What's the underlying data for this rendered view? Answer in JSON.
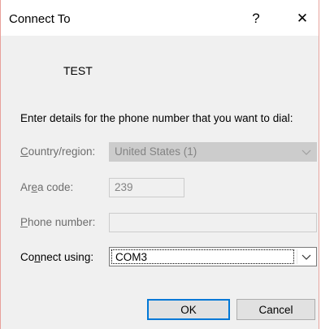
{
  "window": {
    "title": "Connect To",
    "help_label": "?",
    "close_label": "✕"
  },
  "connection": {
    "name": "TEST"
  },
  "form": {
    "instructions": "Enter details for the phone number that you want to dial:",
    "country": {
      "label_pre": "",
      "label_ul": "C",
      "label_post": "ountry/region:",
      "value": "United States (1)",
      "enabled": false
    },
    "area_code": {
      "label_pre": "Ar",
      "label_ul": "e",
      "label_post": "a code:",
      "value": "239",
      "enabled": false
    },
    "phone_number": {
      "label_pre": "",
      "label_ul": "P",
      "label_post": "hone number:",
      "value": "",
      "enabled": false
    },
    "connect_using": {
      "label_pre": "Co",
      "label_ul": "n",
      "label_post": "nect using:",
      "value": "COM3",
      "enabled": true
    }
  },
  "buttons": {
    "ok_label": "OK",
    "cancel_label": "Cancel"
  },
  "icons": {
    "chevron": "chevron-down-icon"
  },
  "colors": {
    "default_button_border": "#0078d7",
    "disabled_text": "#838383",
    "window_border": "#e8a09a"
  }
}
